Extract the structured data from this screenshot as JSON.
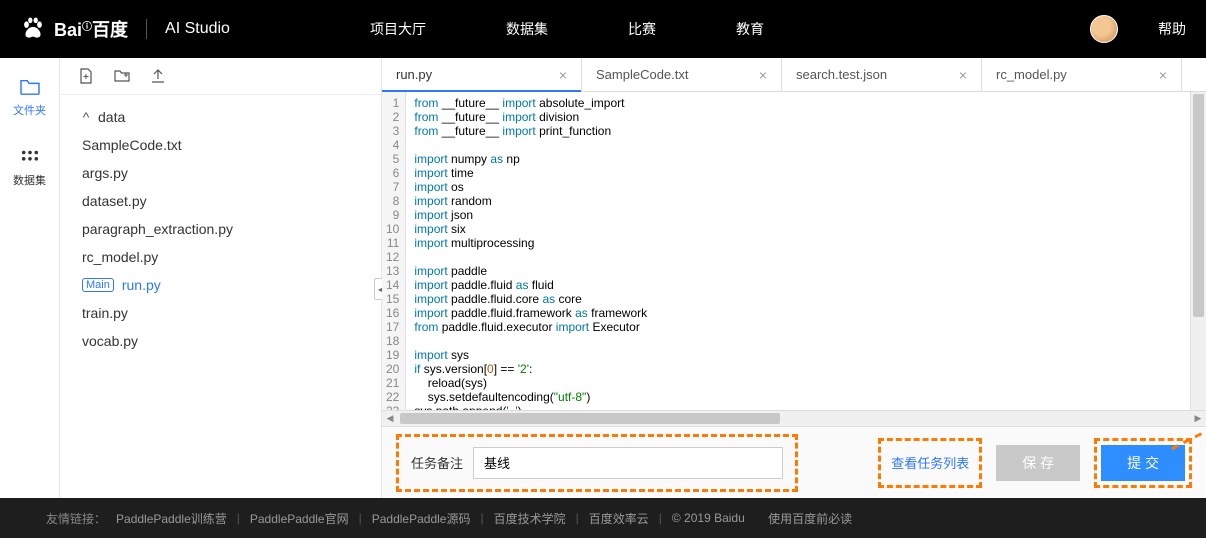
{
  "header": {
    "brand": "Bai",
    "brand2": "百度",
    "product": "AI Studio",
    "nav": [
      "项目大厅",
      "数据集",
      "比赛",
      "教育"
    ],
    "help": "帮助"
  },
  "rail": {
    "files_label": "文件夹",
    "dataset_label": "数据集"
  },
  "tree": {
    "folder": "data",
    "items": [
      "SampleCode.txt",
      "args.py",
      "dataset.py",
      "paragraph_extraction.py",
      "rc_model.py",
      "run.py",
      "train.py",
      "vocab.py"
    ],
    "main_badge": "Main"
  },
  "tabs": [
    {
      "label": "run.py",
      "active": true
    },
    {
      "label": "SampleCode.txt",
      "active": false
    },
    {
      "label": "search.test.json",
      "active": false
    },
    {
      "label": "rc_model.py",
      "active": false
    }
  ],
  "code": {
    "lines": [
      [
        [
          "kw",
          "from"
        ],
        [
          "",
          " __future__ "
        ],
        [
          "kw",
          "import"
        ],
        [
          "",
          " absolute_import"
        ]
      ],
      [
        [
          "kw",
          "from"
        ],
        [
          "",
          " __future__ "
        ],
        [
          "kw",
          "import"
        ],
        [
          "",
          " division"
        ]
      ],
      [
        [
          "kw",
          "from"
        ],
        [
          "",
          " __future__ "
        ],
        [
          "kw",
          "import"
        ],
        [
          "",
          " print_function"
        ]
      ],
      [
        [
          "",
          ""
        ]
      ],
      [
        [
          "kw",
          "import"
        ],
        [
          "",
          " numpy "
        ],
        [
          "kw",
          "as"
        ],
        [
          "",
          " np"
        ]
      ],
      [
        [
          "kw",
          "import"
        ],
        [
          "",
          " time"
        ]
      ],
      [
        [
          "kw",
          "import"
        ],
        [
          "",
          " os"
        ]
      ],
      [
        [
          "kw",
          "import"
        ],
        [
          "",
          " random"
        ]
      ],
      [
        [
          "kw",
          "import"
        ],
        [
          "",
          " json"
        ]
      ],
      [
        [
          "kw",
          "import"
        ],
        [
          "",
          " six"
        ]
      ],
      [
        [
          "kw",
          "import"
        ],
        [
          "",
          " multiprocessing"
        ]
      ],
      [
        [
          "",
          ""
        ]
      ],
      [
        [
          "kw",
          "import"
        ],
        [
          "",
          " paddle"
        ]
      ],
      [
        [
          "kw",
          "import"
        ],
        [
          "",
          " paddle.fluid "
        ],
        [
          "kw",
          "as"
        ],
        [
          "",
          " fluid"
        ]
      ],
      [
        [
          "kw",
          "import"
        ],
        [
          "",
          " paddle.fluid.core "
        ],
        [
          "kw",
          "as"
        ],
        [
          "",
          " core"
        ]
      ],
      [
        [
          "kw",
          "import"
        ],
        [
          "",
          " paddle.fluid.framework "
        ],
        [
          "kw",
          "as"
        ],
        [
          "",
          " framework"
        ]
      ],
      [
        [
          "kw",
          "from"
        ],
        [
          "",
          " paddle.fluid.executor "
        ],
        [
          "kw",
          "import"
        ],
        [
          "",
          " Executor"
        ]
      ],
      [
        [
          "",
          ""
        ]
      ],
      [
        [
          "kw",
          "import"
        ],
        [
          "",
          " sys"
        ]
      ],
      [
        [
          "kw",
          "if"
        ],
        [
          "",
          " sys.version["
        ],
        [
          "num",
          "0"
        ],
        [
          "",
          "] == "
        ],
        [
          "str",
          "'2'"
        ],
        [
          "",
          ":"
        ]
      ],
      [
        [
          "",
          "    reload(sys)"
        ]
      ],
      [
        [
          "",
          "    sys.setdefaultencoding("
        ],
        [
          "str",
          "\"utf-8\""
        ],
        [
          "",
          ")"
        ]
      ],
      [
        [
          "",
          "sys.path.append("
        ],
        [
          "str",
          "'..'"
        ],
        [
          "",
          ")"
        ]
      ],
      [
        [
          "",
          ""
        ]
      ]
    ]
  },
  "runbar": {
    "remark_label": "任务备注",
    "remark_value": "基线",
    "view_tasks": "查看任务列表",
    "save": "保 存",
    "submit": "提 交"
  },
  "footer": {
    "label": "友情链接：",
    "links": [
      "PaddlePaddle训练营",
      "PaddlePaddle官网",
      "PaddlePaddle源码",
      "百度技术学院",
      "百度效率云"
    ],
    "copyright": "© 2019 Baidu",
    "must_read": "使用百度前必读"
  }
}
